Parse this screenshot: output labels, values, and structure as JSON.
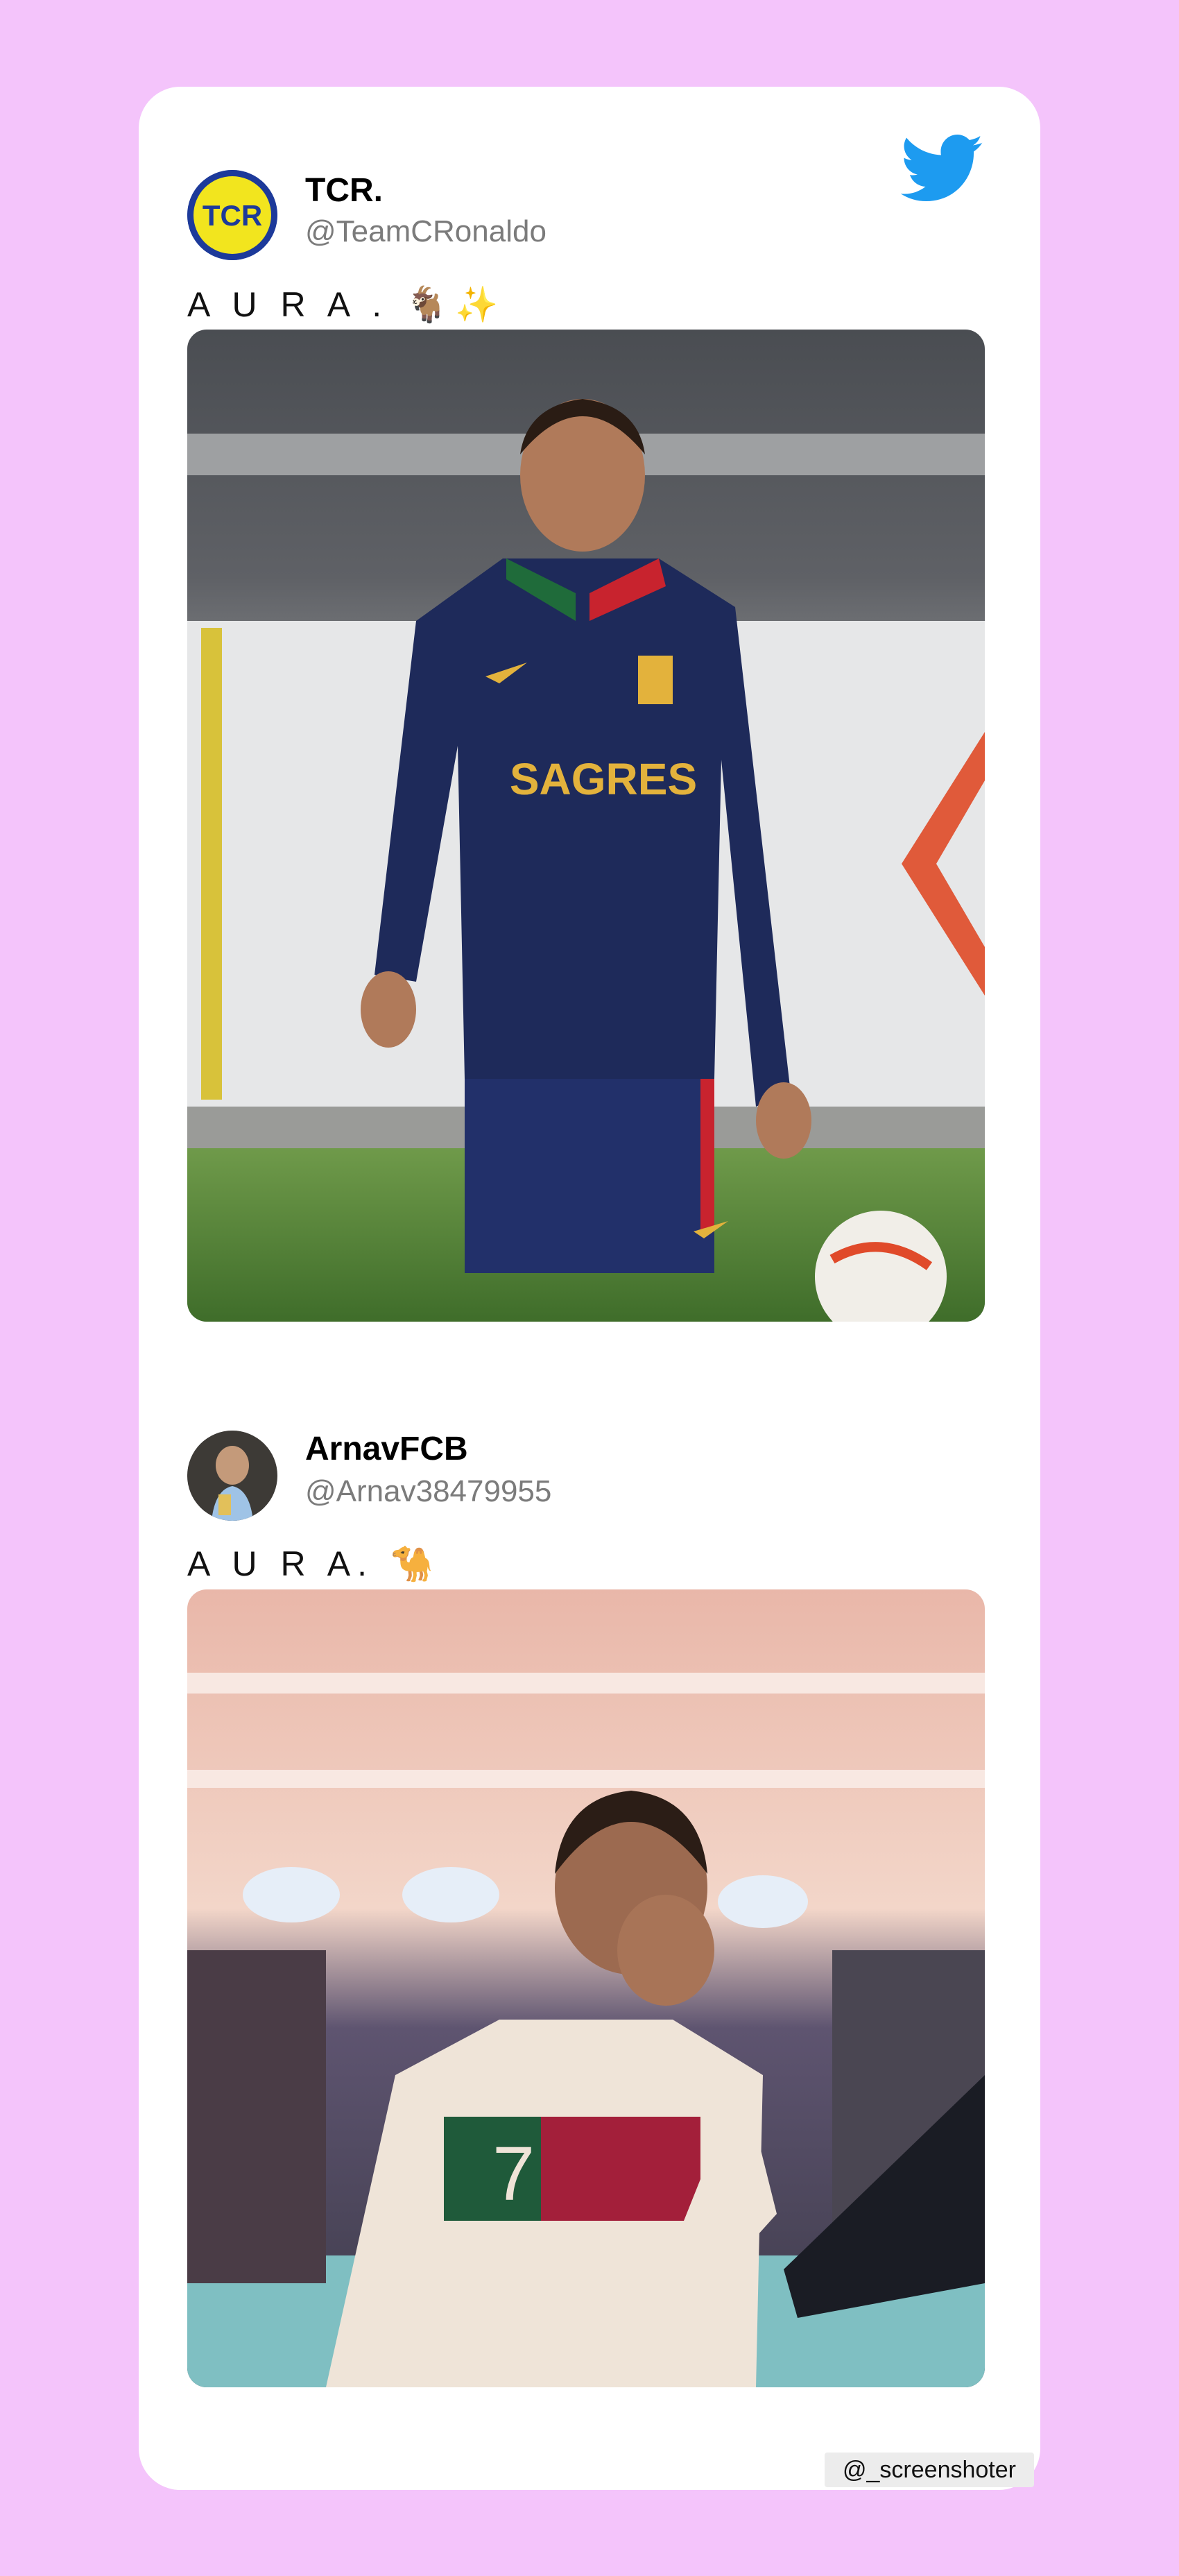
{
  "tweets": [
    {
      "display_name": "TCR.",
      "handle": "@TeamCRonaldo",
      "text": "A U R A . 🐐✨",
      "avatar_text": "TCR"
    },
    {
      "display_name": "ArnavFCB",
      "handle": "@Arnav38479955",
      "text": "A U R A. 🐪",
      "avatar_text": ""
    }
  ],
  "jersey": {
    "sponsor": "SAGRES",
    "number": "7"
  },
  "watermark": "@_screenshoter",
  "colors": {
    "background": "#f4c4fb",
    "card": "#ffffff",
    "twitter_blue": "#1d9bf0",
    "handle_gray": "#7b7b7b"
  },
  "icons": {
    "brand": "twitter-bird-icon"
  }
}
